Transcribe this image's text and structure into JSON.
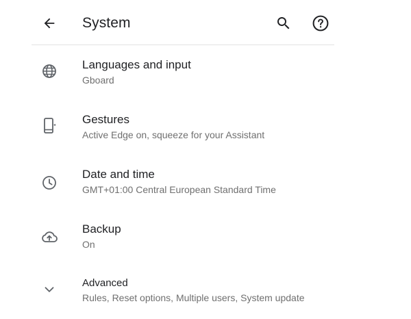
{
  "header": {
    "title": "System",
    "icons": {
      "back": "arrow-back-icon",
      "search": "search-icon",
      "help": "help-circle-icon"
    }
  },
  "items": [
    {
      "title": "Languages and input",
      "summary": "Gboard",
      "icon": "globe-icon"
    },
    {
      "title": "Gestures",
      "summary": "Active Edge on, squeeze for your Assistant",
      "icon": "phone-gesture-icon"
    },
    {
      "title": "Date and time",
      "summary": "GMT+01:00 Central European Standard Time",
      "icon": "clock-icon"
    },
    {
      "title": "Backup",
      "summary": "On",
      "icon": "cloud-upload-icon"
    },
    {
      "title": "Advanced",
      "summary": "Rules, Reset options, Multiple users, System update",
      "icon": "chevron-down-icon"
    }
  ],
  "colors": {
    "primary_text": "#202124",
    "secondary_text": "#6f6f6f",
    "icon": "#5f6368",
    "divider": "#e2e2e2"
  }
}
